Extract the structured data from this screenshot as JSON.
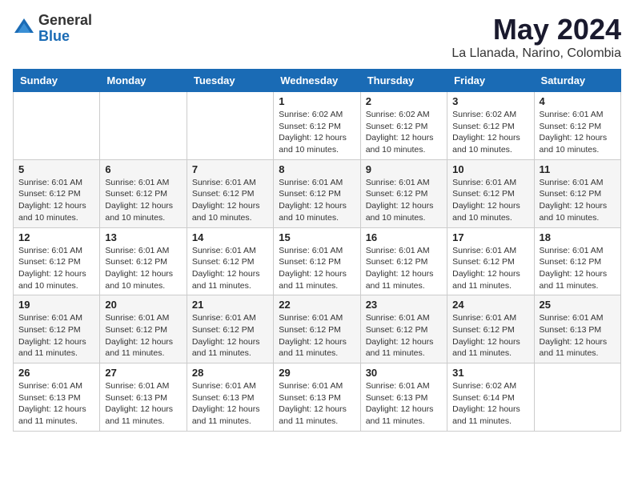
{
  "logo": {
    "general": "General",
    "blue": "Blue"
  },
  "header": {
    "title": "May 2024",
    "subtitle": "La Llanada, Narino, Colombia"
  },
  "weekdays": [
    "Sunday",
    "Monday",
    "Tuesday",
    "Wednesday",
    "Thursday",
    "Friday",
    "Saturday"
  ],
  "weeks": [
    [
      {
        "day": "",
        "info": ""
      },
      {
        "day": "",
        "info": ""
      },
      {
        "day": "",
        "info": ""
      },
      {
        "day": "1",
        "info": "Sunrise: 6:02 AM\nSunset: 6:12 PM\nDaylight: 12 hours\nand 10 minutes."
      },
      {
        "day": "2",
        "info": "Sunrise: 6:02 AM\nSunset: 6:12 PM\nDaylight: 12 hours\nand 10 minutes."
      },
      {
        "day": "3",
        "info": "Sunrise: 6:02 AM\nSunset: 6:12 PM\nDaylight: 12 hours\nand 10 minutes."
      },
      {
        "day": "4",
        "info": "Sunrise: 6:01 AM\nSunset: 6:12 PM\nDaylight: 12 hours\nand 10 minutes."
      }
    ],
    [
      {
        "day": "5",
        "info": "Sunrise: 6:01 AM\nSunset: 6:12 PM\nDaylight: 12 hours\nand 10 minutes."
      },
      {
        "day": "6",
        "info": "Sunrise: 6:01 AM\nSunset: 6:12 PM\nDaylight: 12 hours\nand 10 minutes."
      },
      {
        "day": "7",
        "info": "Sunrise: 6:01 AM\nSunset: 6:12 PM\nDaylight: 12 hours\nand 10 minutes."
      },
      {
        "day": "8",
        "info": "Sunrise: 6:01 AM\nSunset: 6:12 PM\nDaylight: 12 hours\nand 10 minutes."
      },
      {
        "day": "9",
        "info": "Sunrise: 6:01 AM\nSunset: 6:12 PM\nDaylight: 12 hours\nand 10 minutes."
      },
      {
        "day": "10",
        "info": "Sunrise: 6:01 AM\nSunset: 6:12 PM\nDaylight: 12 hours\nand 10 minutes."
      },
      {
        "day": "11",
        "info": "Sunrise: 6:01 AM\nSunset: 6:12 PM\nDaylight: 12 hours\nand 10 minutes."
      }
    ],
    [
      {
        "day": "12",
        "info": "Sunrise: 6:01 AM\nSunset: 6:12 PM\nDaylight: 12 hours\nand 10 minutes."
      },
      {
        "day": "13",
        "info": "Sunrise: 6:01 AM\nSunset: 6:12 PM\nDaylight: 12 hours\nand 10 minutes."
      },
      {
        "day": "14",
        "info": "Sunrise: 6:01 AM\nSunset: 6:12 PM\nDaylight: 12 hours\nand 11 minutes."
      },
      {
        "day": "15",
        "info": "Sunrise: 6:01 AM\nSunset: 6:12 PM\nDaylight: 12 hours\nand 11 minutes."
      },
      {
        "day": "16",
        "info": "Sunrise: 6:01 AM\nSunset: 6:12 PM\nDaylight: 12 hours\nand 11 minutes."
      },
      {
        "day": "17",
        "info": "Sunrise: 6:01 AM\nSunset: 6:12 PM\nDaylight: 12 hours\nand 11 minutes."
      },
      {
        "day": "18",
        "info": "Sunrise: 6:01 AM\nSunset: 6:12 PM\nDaylight: 12 hours\nand 11 minutes."
      }
    ],
    [
      {
        "day": "19",
        "info": "Sunrise: 6:01 AM\nSunset: 6:12 PM\nDaylight: 12 hours\nand 11 minutes."
      },
      {
        "day": "20",
        "info": "Sunrise: 6:01 AM\nSunset: 6:12 PM\nDaylight: 12 hours\nand 11 minutes."
      },
      {
        "day": "21",
        "info": "Sunrise: 6:01 AM\nSunset: 6:12 PM\nDaylight: 12 hours\nand 11 minutes."
      },
      {
        "day": "22",
        "info": "Sunrise: 6:01 AM\nSunset: 6:12 PM\nDaylight: 12 hours\nand 11 minutes."
      },
      {
        "day": "23",
        "info": "Sunrise: 6:01 AM\nSunset: 6:12 PM\nDaylight: 12 hours\nand 11 minutes."
      },
      {
        "day": "24",
        "info": "Sunrise: 6:01 AM\nSunset: 6:12 PM\nDaylight: 12 hours\nand 11 minutes."
      },
      {
        "day": "25",
        "info": "Sunrise: 6:01 AM\nSunset: 6:13 PM\nDaylight: 12 hours\nand 11 minutes."
      }
    ],
    [
      {
        "day": "26",
        "info": "Sunrise: 6:01 AM\nSunset: 6:13 PM\nDaylight: 12 hours\nand 11 minutes."
      },
      {
        "day": "27",
        "info": "Sunrise: 6:01 AM\nSunset: 6:13 PM\nDaylight: 12 hours\nand 11 minutes."
      },
      {
        "day": "28",
        "info": "Sunrise: 6:01 AM\nSunset: 6:13 PM\nDaylight: 12 hours\nand 11 minutes."
      },
      {
        "day": "29",
        "info": "Sunrise: 6:01 AM\nSunset: 6:13 PM\nDaylight: 12 hours\nand 11 minutes."
      },
      {
        "day": "30",
        "info": "Sunrise: 6:01 AM\nSunset: 6:13 PM\nDaylight: 12 hours\nand 11 minutes."
      },
      {
        "day": "31",
        "info": "Sunrise: 6:02 AM\nSunset: 6:14 PM\nDaylight: 12 hours\nand 11 minutes."
      },
      {
        "day": "",
        "info": ""
      }
    ]
  ]
}
